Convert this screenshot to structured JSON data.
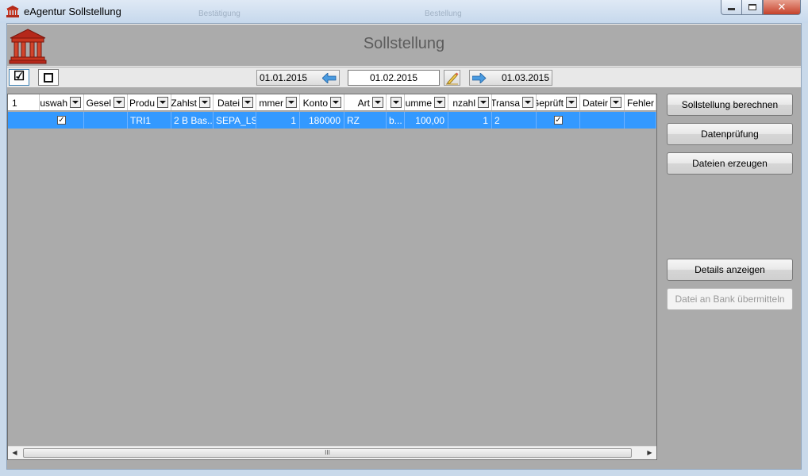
{
  "window": {
    "title": "eAgentur Sollstellung",
    "ghost_tabs": [
      "Bestätigung",
      "Bestellung"
    ],
    "controls": {
      "minimize": "–",
      "maximize": "□",
      "close": "✕"
    }
  },
  "header": {
    "title": "Sollstellung",
    "logo_icon": "bank-building-icon"
  },
  "toolbar": {
    "select_all_icon": "☑",
    "deselect_all_icon": "☐",
    "date_prev": "01.01.2015",
    "date_current": "01.02.2015",
    "date_next": "01.03.2015",
    "icons": {
      "prev": "arrow-left-icon",
      "edit": "pencil-icon",
      "next": "arrow-right-icon"
    }
  },
  "grid": {
    "row_header_label": "1",
    "columns": [
      {
        "label": "uswah"
      },
      {
        "label": "Gesel"
      },
      {
        "label": "Produ"
      },
      {
        "label": "Zahlst"
      },
      {
        "label": "Datei"
      },
      {
        "label": "mmer"
      },
      {
        "label": "Konto"
      },
      {
        "label": "Art"
      },
      {
        "label": ""
      },
      {
        "label": "umme"
      },
      {
        "label": "nzahl"
      },
      {
        "label": "Transa"
      },
      {
        "label": "Geprüft"
      },
      {
        "label": "Dateir"
      },
      {
        "label": "Fehler"
      }
    ],
    "rows": [
      {
        "selected": true,
        "cells": [
          "✓",
          "",
          "TRI1",
          "2 B Bas...",
          "SEPA_LS",
          "1",
          "180000",
          "RZ",
          "b...",
          "100,00",
          "1",
          "2",
          "✓",
          "",
          ""
        ]
      }
    ],
    "scroll_grip": "III"
  },
  "actions": {
    "calculate": "Sollstellung berechnen",
    "check": "Datenprüfung",
    "create_files": "Dateien erzeugen",
    "details": "Details anzeigen",
    "transmit": "Datei an Bank übermitteln"
  }
}
